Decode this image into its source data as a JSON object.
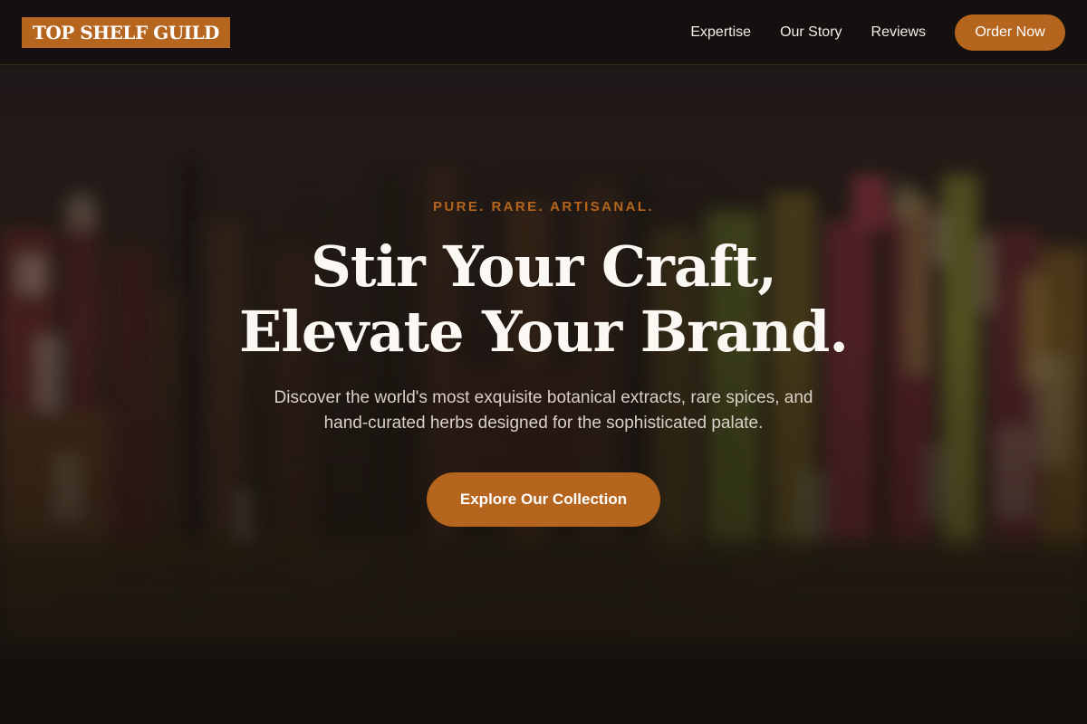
{
  "header": {
    "logo_text": "TOP SHELF GUILD",
    "nav": [
      {
        "label": "Expertise"
      },
      {
        "label": "Our Story"
      },
      {
        "label": "Reviews"
      }
    ],
    "order_button": "Order Now"
  },
  "hero": {
    "tagline": "PURE. RARE. ARTISANAL.",
    "headline_line1": "Stir Your Craft,",
    "headline_line2": "Elevate Your Brand.",
    "subtext_line1": "Discover the world's most exquisite botanical extracts, rare spices, and",
    "subtext_line2": "hand-curated herbs designed for the sophisticated palate.",
    "cta_label": "Explore Our Collection"
  },
  "colors": {
    "accent": "#b5651d",
    "header_bg": "#141010",
    "text_light": "#fbf7f2"
  }
}
